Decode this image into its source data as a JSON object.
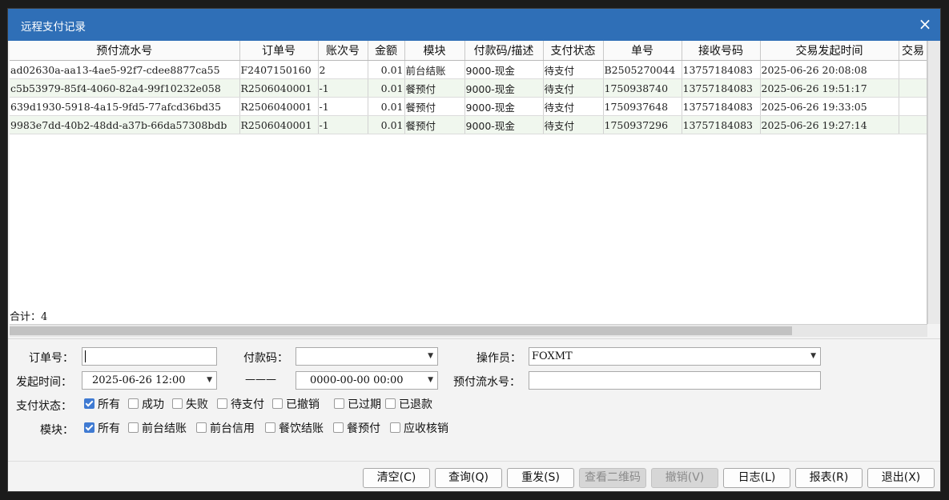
{
  "window": {
    "title": "远程支付记录",
    "close_glyph": "×"
  },
  "table": {
    "columns": [
      "预付流水号",
      "订单号",
      "账次号",
      "金额",
      "模块",
      "付款码/描述",
      "支付状态",
      "单号",
      "接收号码",
      "交易发起时间",
      "交易"
    ],
    "rows": [
      [
        "ad02630a-aa13-4ae5-92f7-cdee8877ca55",
        "F2407150160",
        "2",
        "0.01",
        "前台结账",
        "9000-现金",
        "待支付",
        "B2505270044",
        "13757184083",
        "2025-06-26  20:08:08",
        ""
      ],
      [
        "c5b53979-85f4-4060-82a4-99f10232e058",
        "R2506040001",
        "-1",
        "0.01",
        "餐预付",
        "9000-现金",
        "待支付",
        "1750938740",
        "13757184083",
        "2025-06-26  19:51:17",
        ""
      ],
      [
        "639d1930-5918-4a15-9fd5-77afcd36bd35",
        "R2506040001",
        "-1",
        "0.01",
        "餐预付",
        "9000-现金",
        "待支付",
        "1750937648",
        "13757184083",
        "2025-06-26  19:33:05",
        ""
      ],
      [
        "9983e7dd-40b2-48dd-a37b-66da57308bdb",
        "R2506040001",
        "-1",
        "0.01",
        "餐预付",
        "9000-现金",
        "待支付",
        "1750937296",
        "13757184083",
        "2025-06-26  19:27:14",
        ""
      ]
    ],
    "total_label": "合计：",
    "total_value": "4"
  },
  "form": {
    "order_no_label": "订单号：",
    "order_no_value": "",
    "pay_code_label": "付款码：",
    "pay_code_value": "",
    "operator_label": "操作员：",
    "operator_value": "FOXMT",
    "start_time_label": "发起时间：",
    "start_time_value": "2025-06-26  12:00",
    "range_sep": "———",
    "end_time_value": "0000-00-00  00:00",
    "prepay_no_label": "预付流水号：",
    "prepay_no_value": "",
    "status_label": "支付状态：",
    "status_options": [
      {
        "label": "所有",
        "checked": true
      },
      {
        "label": "成功",
        "checked": false
      },
      {
        "label": "失败",
        "checked": false
      },
      {
        "label": "待支付",
        "checked": false
      },
      {
        "label": "已撤销",
        "checked": false
      },
      {
        "label": "已过期",
        "checked": false
      },
      {
        "label": "已退款",
        "checked": false
      }
    ],
    "module_label": "模块：",
    "module_options": [
      {
        "label": "所有",
        "checked": true
      },
      {
        "label": "前台结账",
        "checked": false
      },
      {
        "label": "前台信用",
        "checked": false
      },
      {
        "label": "餐饮结账",
        "checked": false
      },
      {
        "label": "餐预付",
        "checked": false
      },
      {
        "label": "应收核销",
        "checked": false
      }
    ]
  },
  "buttons": {
    "clear": "清空(C)",
    "query": "查询(Q)",
    "resend": "重发(S)",
    "view_qr": "查看二维码",
    "cancel": "撤销(V)",
    "log": "日志(L)",
    "report": "报表(R)",
    "exit": "退出(X)"
  },
  "icons": {
    "dropdown": "chevron-down-icon",
    "check": "checkbox-checked-icon"
  },
  "colors": {
    "titlebar": "#2f6fb7",
    "row_alt": "#f0f7ee",
    "checkbox_on": "#3f7ad2"
  }
}
